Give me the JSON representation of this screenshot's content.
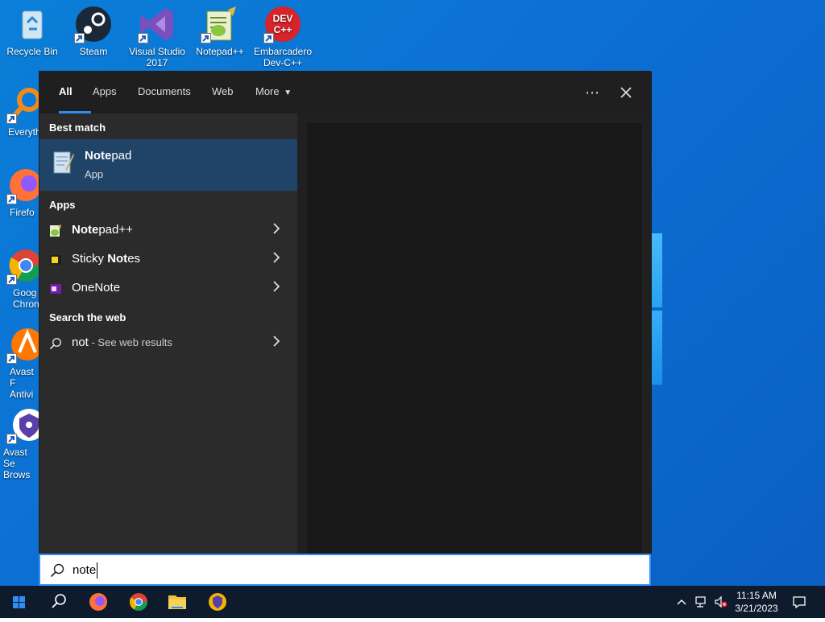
{
  "desktop_icons": [
    {
      "label": "Recycle Bin",
      "icon": "recycle-bin-icon"
    },
    {
      "label": "Steam",
      "icon": "steam-icon"
    },
    {
      "label": "Visual Studio 2017",
      "icon": "visual-studio-icon"
    },
    {
      "label": "Notepad++",
      "icon": "notepad-plus-plus-icon"
    },
    {
      "label": "Embarcadero Dev-C++",
      "icon": "devcpp-icon"
    },
    {
      "label": "Everyth",
      "icon": "everything-icon"
    },
    {
      "label": "Firefo",
      "icon": "firefox-icon"
    },
    {
      "label": "Goog Chron",
      "icon": "chrome-icon"
    },
    {
      "label": "Avast F Antivi",
      "icon": "avast-icon"
    },
    {
      "label": "Avast Se Brows",
      "icon": "avast-browser-icon"
    }
  ],
  "search": {
    "tabs": [
      {
        "label": "All",
        "active": true
      },
      {
        "label": "Apps"
      },
      {
        "label": "Documents"
      },
      {
        "label": "Web"
      },
      {
        "label": "More"
      }
    ],
    "best_match_header": "Best match",
    "best_match": {
      "bold": "Note",
      "rest": "pad",
      "subtitle": "App"
    },
    "apps_header": "Apps",
    "apps": [
      {
        "bold": "Note",
        "rest": "pad++",
        "icon": "notepad-plus-plus-icon"
      },
      {
        "pre": "Sticky ",
        "bold": "Not",
        "rest": "es",
        "icon": "sticky-notes-icon"
      },
      {
        "pre": "OneNote",
        "icon": "onenote-icon"
      }
    ],
    "web_header": "Search the web",
    "web": {
      "query": "not",
      "hint": " - See web results"
    },
    "input_value": "note"
  },
  "taskbar": {
    "time": "11:15 AM",
    "date": "3/21/2023"
  },
  "colors": {
    "accent": "#2f8df6",
    "selected": "#1f4468",
    "panel": "#2b2b2b",
    "taskbar": "#0d1b2d"
  }
}
